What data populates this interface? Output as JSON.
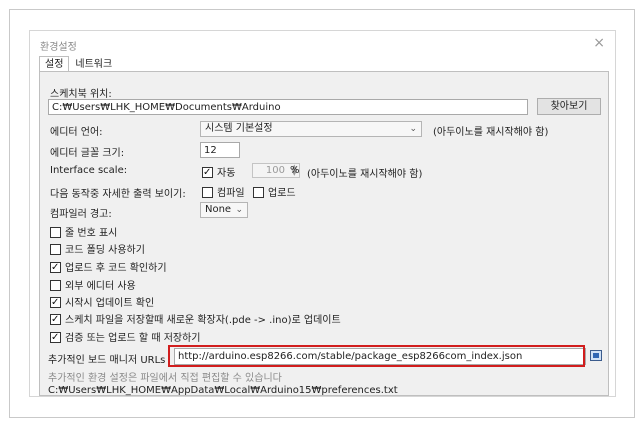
{
  "window": {
    "title": "환경설정",
    "close": "×"
  },
  "tabs": [
    {
      "label": "설정"
    },
    {
      "label": "네트워크"
    }
  ],
  "sketchbook": {
    "label": "스케치북 위치:",
    "path": "C:₩Users₩LHK_HOME₩Documents₩Arduino",
    "browse_label": "찾아보기"
  },
  "editor_language": {
    "label": "에디터 언어:",
    "value": "시스템 기본설정",
    "note": "(아두이노를 재시작해야 함)"
  },
  "font_size": {
    "label": "에디터 글꼴 크기:",
    "value": "12"
  },
  "interface_scale": {
    "label": "Interface scale:",
    "auto_label": "자동",
    "auto_checked": true,
    "value": "100",
    "unit": "%",
    "note": "(아두이노를 재시작해야 함)"
  },
  "verbose": {
    "label": "다음 동작중 자세한 출력 보이기:",
    "compile_label": "컴파일",
    "compile_checked": false,
    "upload_label": "업로드",
    "upload_checked": false
  },
  "compiler_warnings": {
    "label": "컴파일러 경고:",
    "value": "None"
  },
  "options": [
    {
      "label": "줄 번호 표시",
      "checked": false
    },
    {
      "label": "코드 폴딩 사용하기",
      "checked": false
    },
    {
      "label": "업로드 후 코드 확인하기",
      "checked": true
    },
    {
      "label": "외부 에디터 사용",
      "checked": false
    },
    {
      "label": "시작시 업데이트 확인",
      "checked": true
    },
    {
      "label": "스케치 파일을 저장할때 새로운 확장자(.pde -> .ino)로 업데이트",
      "checked": true
    },
    {
      "label": "검증 또는 업로드 할 때 저장하기",
      "checked": true
    }
  ],
  "board_manager": {
    "label": "추가적인 보드 매니저 URLs",
    "url": "http://arduino.esp8266.com/stable/package_esp8266com_index.json"
  },
  "footer": {
    "note": "추가적인 환경 설정은 파일에서 직접 편집할 수 있습니다",
    "prefs_path": "C:₩Users₩LHK_HOME₩AppData₩Local₩Arduino15₩preferences.txt"
  },
  "colors": {
    "highlight": "#d11d1d",
    "panel_bg": "#f0f0f0"
  }
}
